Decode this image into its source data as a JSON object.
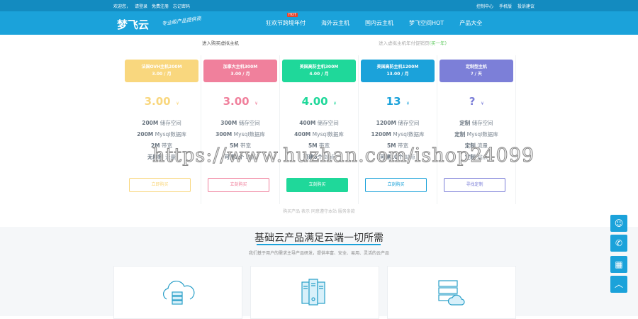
{
  "topbar": {
    "left": [
      "欢迎您，",
      "请登录",
      "免费注册",
      "忘记密码"
    ],
    "right": [
      "控制中心",
      "手机版",
      "投诉建议"
    ]
  },
  "nav": {
    "logo": "梦飞云",
    "slogan": "专业级产品提供商",
    "hot_badge": "HOT",
    "menu": [
      "狂欢节跨境年付",
      "海外云主机",
      "国内云主机",
      "梦飞空间HOT",
      "产品大全"
    ]
  },
  "sublinks": {
    "left": "进入购买虚拟主机",
    "right": "进入虚拟主机年付促销页",
    "right_highlight": "(买一年)"
  },
  "plans": [
    {
      "name": "法国OVH主机200M",
      "period": "3.00 / 月",
      "price": "3.00",
      "currency": "¥",
      "color": "#f9d77e",
      "features": [
        [
          "200M",
          "储存空间"
        ],
        [
          "200M",
          "Mysql数据库"
        ],
        [
          "2M",
          "带宽"
        ],
        [
          "无限制",
          "流量"
        ]
      ],
      "button": "立即购买"
    },
    {
      "name": "加拿大主机300M",
      "period": "3.00 / 月",
      "price": "3.00",
      "currency": "¥",
      "color": "#f0809c",
      "features": [
        [
          "300M",
          "储存空间"
        ],
        [
          "300M",
          "Mysql数据库"
        ],
        [
          "5M",
          "带宽"
        ],
        [
          "可建2个",
          "站点"
        ]
      ],
      "button": "立刻购买"
    },
    {
      "name": "美国高防主机300M",
      "period": "4.00 / 月",
      "price": "4.00",
      "currency": "¥",
      "color": "#1fd89a",
      "features": [
        [
          "400M",
          "储存空间"
        ],
        [
          "400M",
          "Mysql数据库"
        ],
        [
          "5M",
          "带宽"
        ],
        [
          "可建6个",
          "站点"
        ]
      ],
      "button": "立刻购买"
    },
    {
      "name": "美国高防主机1200M",
      "period": "13.00 / 月",
      "price": "13",
      "currency": "¥",
      "color": "#1ba2da",
      "features": [
        [
          "1200M",
          "储存空间"
        ],
        [
          "1200M",
          "Mysql数据库"
        ],
        [
          "5M",
          "带宽"
        ],
        [
          "可建10个",
          "站点"
        ]
      ],
      "button": "立刻购买"
    },
    {
      "name": "定制型主机",
      "period": "? / 天",
      "price": "?",
      "currency": "¥",
      "color": "#7c7fd8",
      "features": [
        [
          "定制",
          "储存空间"
        ],
        [
          "定制",
          "Mysql数据库"
        ],
        [
          "定制",
          "流量"
        ],
        [
          "定制",
          "站点"
        ]
      ],
      "button": "寻找定制"
    }
  ],
  "disclaimer": "购买产品 表示 同意遵守本站 服务条款",
  "section": {
    "title": "基础云产品满足云端一切所需",
    "subtitle": "我们基于用户的需求主导产品研发，提供丰富、安全、易用、灵活的云产品"
  },
  "watermark": "https://www.huzhan.com/ishop24099"
}
